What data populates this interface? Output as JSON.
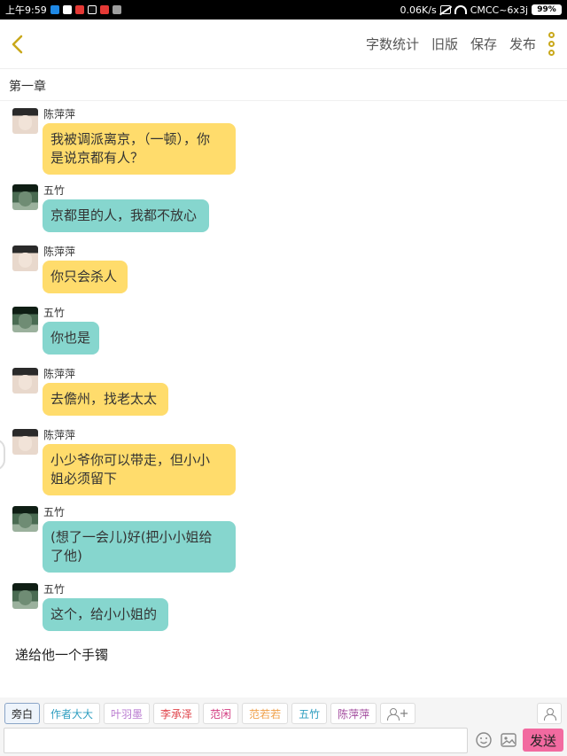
{
  "status_bar": {
    "time": "上午9:59",
    "network_speed": "0.06K/s",
    "carrier": "CMCC~6x3j",
    "battery": "99%"
  },
  "header": {
    "toolbar": [
      {
        "label": "字数统计"
      },
      {
        "label": "旧版"
      },
      {
        "label": "保存"
      },
      {
        "label": "发布"
      }
    ]
  },
  "chapter": {
    "title": "第一章"
  },
  "messages": [
    {
      "speaker": "陈萍萍",
      "text_lines": [
        "我被调派离京，（一顿），你",
        "是说京都有人？"
      ]
    },
    {
      "speaker": "五竹",
      "text_lines": [
        "京都里的人，我都不放心"
      ]
    },
    {
      "speaker": "陈萍萍",
      "text_lines": [
        "你只会杀人"
      ]
    },
    {
      "speaker": "五竹",
      "text_lines": [
        "你也是"
      ]
    },
    {
      "speaker": "陈萍萍",
      "text_lines": [
        "去儋州，找老太太"
      ]
    },
    {
      "speaker": "陈萍萍",
      "text_lines": [
        "小少爷你可以带走，但小小",
        "姐必须留下"
      ]
    },
    {
      "speaker": "五竹",
      "text_lines": [
        "(想了一会儿)好(把小小姐给",
        "了他)"
      ]
    },
    {
      "speaker": "五竹",
      "text_lines": [
        "这个，给小小姐的"
      ]
    }
  ],
  "narration": "递给他一个手镯",
  "roles": [
    {
      "label": "旁白",
      "color": "#222222",
      "active": true
    },
    {
      "label": "作者大大",
      "color": "#2f9ec0"
    },
    {
      "label": "叶羽墨",
      "color": "#b97ad0"
    },
    {
      "label": "李承泽",
      "color": "#e0444b"
    },
    {
      "label": "范闲",
      "color": "#d23c80"
    },
    {
      "label": "范若若",
      "color": "#f0a24c"
    },
    {
      "label": "五竹",
      "color": "#2f9ec0"
    },
    {
      "label": "陈萍萍",
      "color": "#a24a9d"
    }
  ],
  "add_role_label": "+",
  "input": {
    "value": "",
    "placeholder": ""
  },
  "send_label": "发送",
  "colors": {
    "yellow_bubble": "#ffdc6c",
    "teal_bubble": "#86d6ce",
    "accent": "#c9a81b",
    "send": "#f26aa0"
  }
}
